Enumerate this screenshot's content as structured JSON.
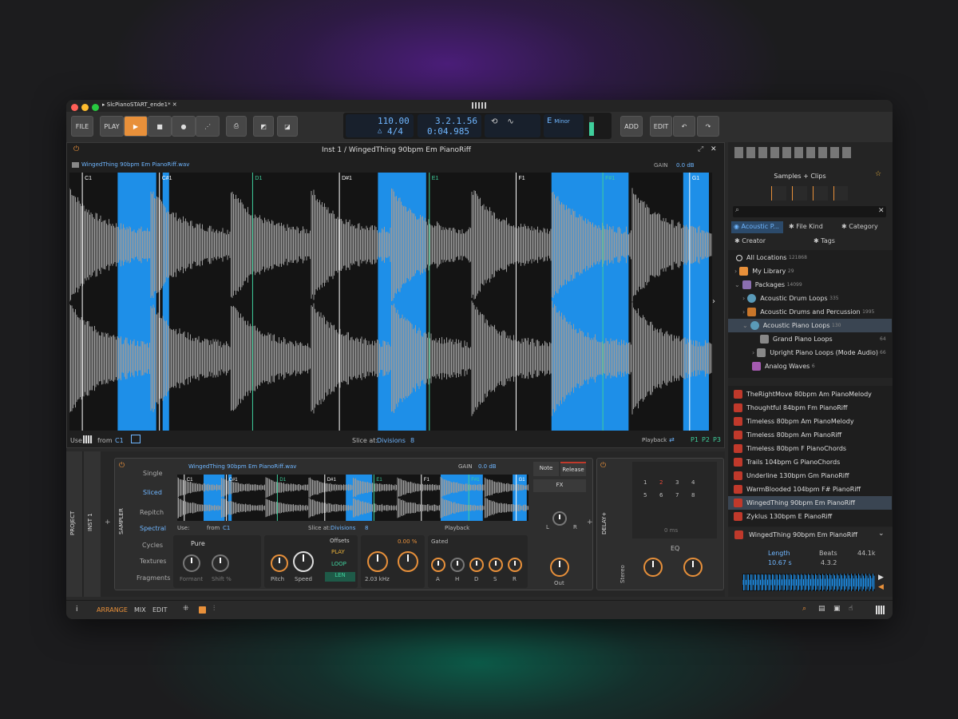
{
  "titlebar": {
    "doc": "SlcPianoSTART_ende1",
    "modified": "*"
  },
  "toolbar": {
    "file": "FILE",
    "play_label": "PLAY",
    "add": "ADD",
    "edit": "EDIT",
    "tempo": "110.00",
    "meter": "4/4",
    "position": "3.2.1.56",
    "time": "0:04.985",
    "key_root": "E",
    "key_mode": "Minor"
  },
  "editor": {
    "title": "Inst 1 / WingedThing 90bpm Em PianoRiff",
    "file": "WingedThing 90bpm Em PianoRiff.wav",
    "gain_label": "GAIN",
    "gain": "0.0 dB",
    "slices": [
      "C1",
      "C#1",
      "D1",
      "D#1",
      "E1",
      "F1",
      "F#1",
      "G1"
    ],
    "use_label": "Use:",
    "from_label": "from",
    "from_value": "C1",
    "slice_label": "Slice at:",
    "slice_mode": "Divisions",
    "divisions": "8",
    "playback": "Playback",
    "p_labels": [
      "P1",
      "P2",
      "P3"
    ]
  },
  "device": {
    "side_tabs": [
      "PROJECT",
      "INST 1",
      "SAMPLER"
    ],
    "delay_tab": "DELAY+",
    "modes": [
      "Single",
      "Sliced"
    ],
    "algos": [
      "Repitch",
      "Spectral",
      "Cycles",
      "Textures",
      "Fragments"
    ],
    "file": "WingedThing 90bpm Em PianoRiff.wav",
    "gain_label": "GAIN",
    "gain": "0.0 dB",
    "slices": [
      "C1",
      "C#1",
      "D1",
      "D#1",
      "E1",
      "F1",
      "F#1",
      "G1"
    ],
    "use": "Use:",
    "from": "from",
    "from_value": "C1",
    "slice_at": "Slice at:",
    "mode": "Divisions",
    "divs": "8",
    "playback": "Playback",
    "pure": "Pure",
    "formant": "Formant",
    "shift": "Shift %",
    "pitch": "Pitch",
    "speed": "Speed",
    "offsets": "Offsets",
    "play": "PLAY",
    "loop": "LOOP",
    "len": "LEN",
    "freq": "2.03 kHz",
    "pct": "0.00 %",
    "gated": "Gated",
    "adsr": [
      "A",
      "H",
      "D",
      "S",
      "R"
    ],
    "note": "Note",
    "release": "Release",
    "fx": "FX",
    "l": "L",
    "r": "R",
    "out": "Out",
    "stereo": "Stereo",
    "nums": [
      "1",
      "2",
      "3",
      "4",
      "5",
      "6",
      "7",
      "8"
    ],
    "ms": "0 ms",
    "eq": "EQ"
  },
  "browser": {
    "title": "Samples + Clips",
    "search_placeholder": "",
    "filters": [
      "Acoustic P...",
      "File Kind",
      "Category",
      "Creator",
      "Tags"
    ],
    "tree": [
      {
        "name": "All Locations",
        "count": "121868"
      },
      {
        "name": "My Library",
        "count": "29"
      },
      {
        "name": "Packages",
        "count": "14099"
      },
      {
        "name": "Acoustic Drum Loops",
        "count": "335"
      },
      {
        "name": "Acoustic Drums and Percussion",
        "count": "1995"
      },
      {
        "name": "Acoustic Piano Loops",
        "count": "130"
      },
      {
        "name": "Grand Piano Loops",
        "count": "64"
      },
      {
        "name": "Upright Piano Loops (Mode Audio)",
        "count": "66"
      },
      {
        "name": "Analog Waves",
        "count": "6"
      }
    ],
    "clips": [
      "TheRightMove 80bpm Am PianoMelody",
      "Thoughtful 84bpm Fm PianoRiff",
      "Timeless 80bpm Am PianoMelody",
      "Timeless 80bpm Am PianoRiff",
      "Timeless 80bpm F PianoChords",
      "Trails 104bpm G PianoChords",
      "Underline 130bpm Gm PianoRiff",
      "WarmBlooded 104bpm F# PianoRiff",
      "WingedThing 90bpm Em PianoRiff",
      "Zyklus 130bpm E PianoRiff"
    ],
    "selected_clip": "WingedThing 90bpm Em PianoRiff",
    "preview": {
      "length_label": "Length",
      "length": "10.67 s",
      "beats_label": "Beats",
      "beats": "4.3.2",
      "rate": "44.1k"
    }
  },
  "statusbar": {
    "info": "i",
    "arrange": "ARRANGE",
    "mix": "MIX",
    "edit": "EDIT"
  },
  "colors": {
    "accent": "#e8903a",
    "blue": "#1e8fe8",
    "teal": "#3fcf9c"
  }
}
